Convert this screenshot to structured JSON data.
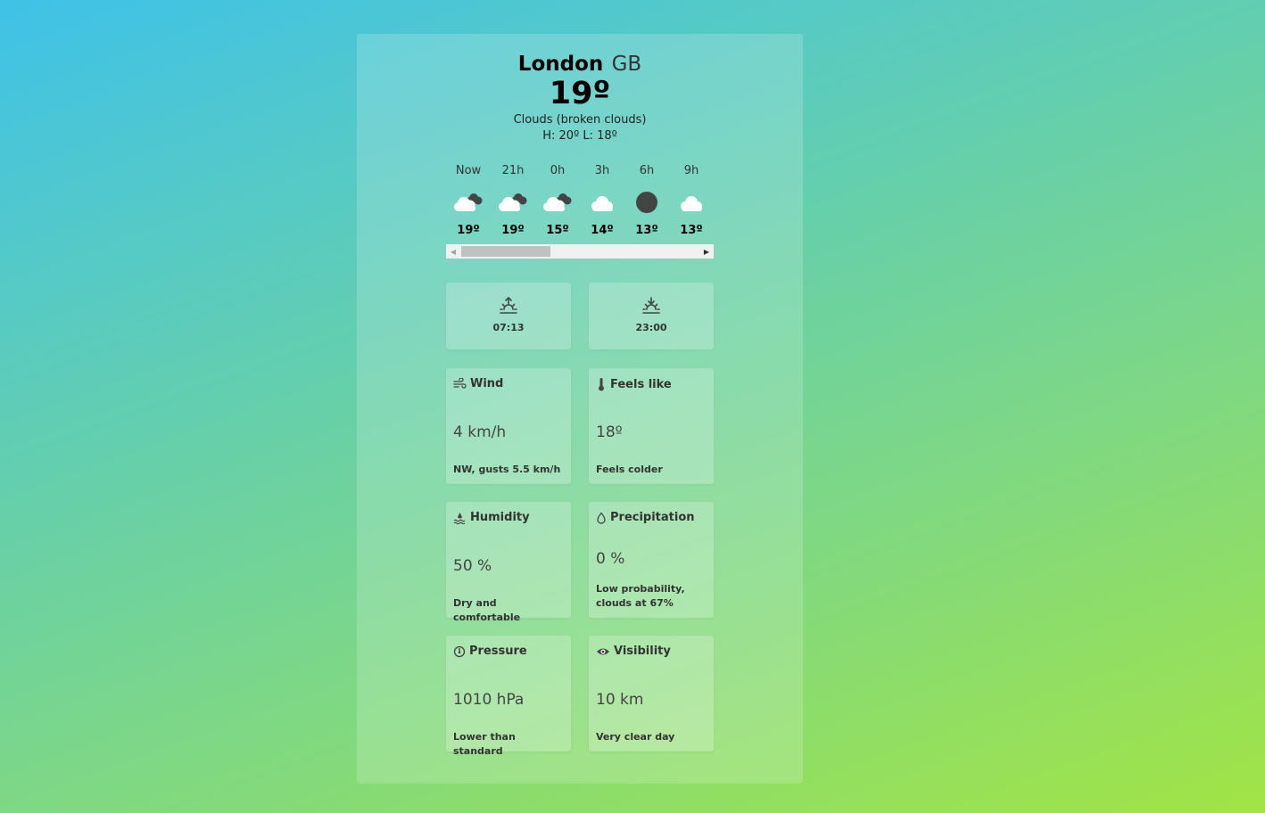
{
  "location": {
    "city": "London",
    "country": "GB"
  },
  "current": {
    "temp": "19º",
    "description": "Clouds (broken clouds)",
    "hilo": "H: 20º L: 18º"
  },
  "hourly": [
    {
      "label": "Now",
      "icon": "broken-clouds-icon",
      "temp": "19º"
    },
    {
      "label": "21h",
      "icon": "broken-clouds-icon",
      "temp": "19º"
    },
    {
      "label": "0h",
      "icon": "broken-clouds-icon",
      "temp": "15º"
    },
    {
      "label": "3h",
      "icon": "cloud-icon",
      "temp": "14º"
    },
    {
      "label": "6h",
      "icon": "clear-night-icon",
      "temp": "13º"
    },
    {
      "label": "9h",
      "icon": "cloud-icon",
      "temp": "13º"
    }
  ],
  "sun": {
    "sunrise": "07:13",
    "sunset": "23:00"
  },
  "cards": {
    "wind": {
      "title": "Wind",
      "value": "4 km/h",
      "sub": "NW, gusts 5.5 km/h"
    },
    "feels": {
      "title": "Feels like",
      "value": "18º",
      "sub": "Feels colder"
    },
    "humidity": {
      "title": "Humidity",
      "value": "50 %",
      "sub": "Dry and comfortable"
    },
    "precip": {
      "title": "Precipitation",
      "value": "0 %",
      "sub": "Low probability, clouds at 67%"
    },
    "pressure": {
      "title": "Pressure",
      "value": "1010 hPa",
      "sub": "Lower than standard"
    },
    "visibility": {
      "title": "Visibility",
      "value": "10 km",
      "sub": "Very clear day"
    }
  },
  "colors": {
    "icon_dark": "#444444",
    "cloud_white": "#ffffff"
  }
}
